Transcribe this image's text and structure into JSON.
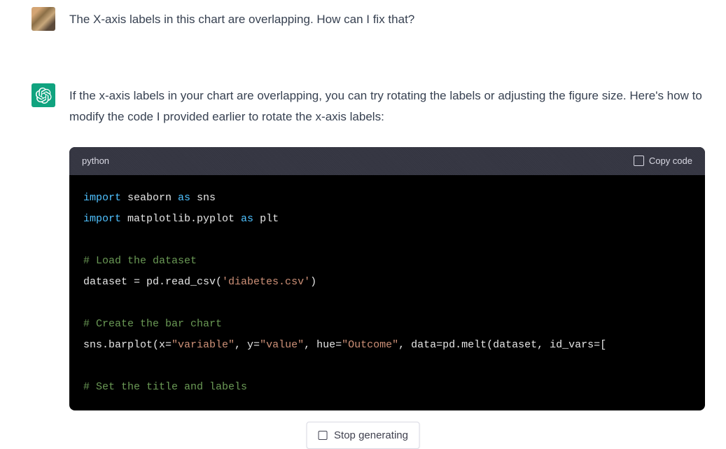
{
  "user_message": {
    "text": "The X-axis labels in this chart are overlapping. How can I fix that?"
  },
  "assistant_message": {
    "text": "If the x-axis labels in your chart are overlapping, you can try rotating the labels or adjusting the figure size. Here's how to modify the code I provided earlier to rotate the x-axis labels:"
  },
  "code_block": {
    "language": "python",
    "copy_label": "Copy code",
    "tokens": {
      "import1": "import",
      "seaborn": " seaborn ",
      "as1": "as",
      "sns": " sns",
      "import2": "import",
      "matplotlib": " matplotlib.pyplot ",
      "as2": "as",
      "plt": " plt",
      "comment1": "# Load the dataset",
      "dataset_line_a": "dataset = pd.read_csv(",
      "dataset_str": "'diabetes.csv'",
      "dataset_line_b": ")",
      "comment2": "# Create the bar chart",
      "barplot_a": "sns.barplot(x=",
      "barplot_str1": "\"variable\"",
      "barplot_b": ", y=",
      "barplot_str2": "\"value\"",
      "barplot_c": ", hue=",
      "barplot_str3": "\"Outcome\"",
      "barplot_d": ", data=pd.melt(dataset, id_vars=[",
      "comment3": "# Set the title and labels"
    }
  },
  "stop_button": {
    "label": "Stop generating"
  }
}
